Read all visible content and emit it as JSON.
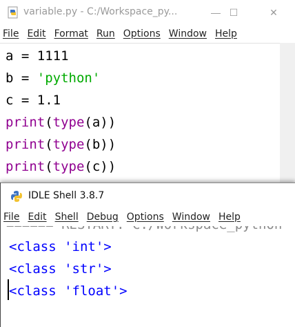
{
  "editor": {
    "title": "variable.py - C:/Workspace_py...",
    "menu": [
      "File",
      "Edit",
      "Format",
      "Run",
      "Options",
      "Window",
      "Help"
    ],
    "code": [
      {
        "parts": [
          {
            "t": "a = 1111",
            "c": "plain"
          }
        ]
      },
      {
        "parts": [
          {
            "t": "b = ",
            "c": "plain"
          },
          {
            "t": "'python'",
            "c": "str"
          }
        ]
      },
      {
        "parts": [
          {
            "t": "c = 1.1",
            "c": "plain"
          }
        ]
      },
      {
        "parts": [
          {
            "t": "print",
            "c": "kw"
          },
          {
            "t": "(",
            "c": "plain"
          },
          {
            "t": "type",
            "c": "kw"
          },
          {
            "t": "(a))",
            "c": "plain"
          }
        ]
      },
      {
        "parts": [
          {
            "t": "print",
            "c": "kw"
          },
          {
            "t": "(",
            "c": "plain"
          },
          {
            "t": "type",
            "c": "kw"
          },
          {
            "t": "(b))",
            "c": "plain"
          }
        ]
      },
      {
        "parts": [
          {
            "t": "print",
            "c": "kw"
          },
          {
            "t": "(",
            "c": "plain"
          },
          {
            "t": "type",
            "c": "kw"
          },
          {
            "t": "(c))",
            "c": "plain"
          }
        ]
      }
    ],
    "window_controls": {
      "minimize": "—",
      "maximize": "☐",
      "close": "✕"
    }
  },
  "shell": {
    "title": "IDLE Shell 3.8.7",
    "menu": [
      "File",
      "Edit",
      "Shell",
      "Debug",
      "Options",
      "Window",
      "Help"
    ],
    "restart_text": "====== RESTART: C:/Workspace_python",
    "output": [
      "<class 'int'>",
      "<class 'str'>",
      "<class 'float'>"
    ]
  }
}
